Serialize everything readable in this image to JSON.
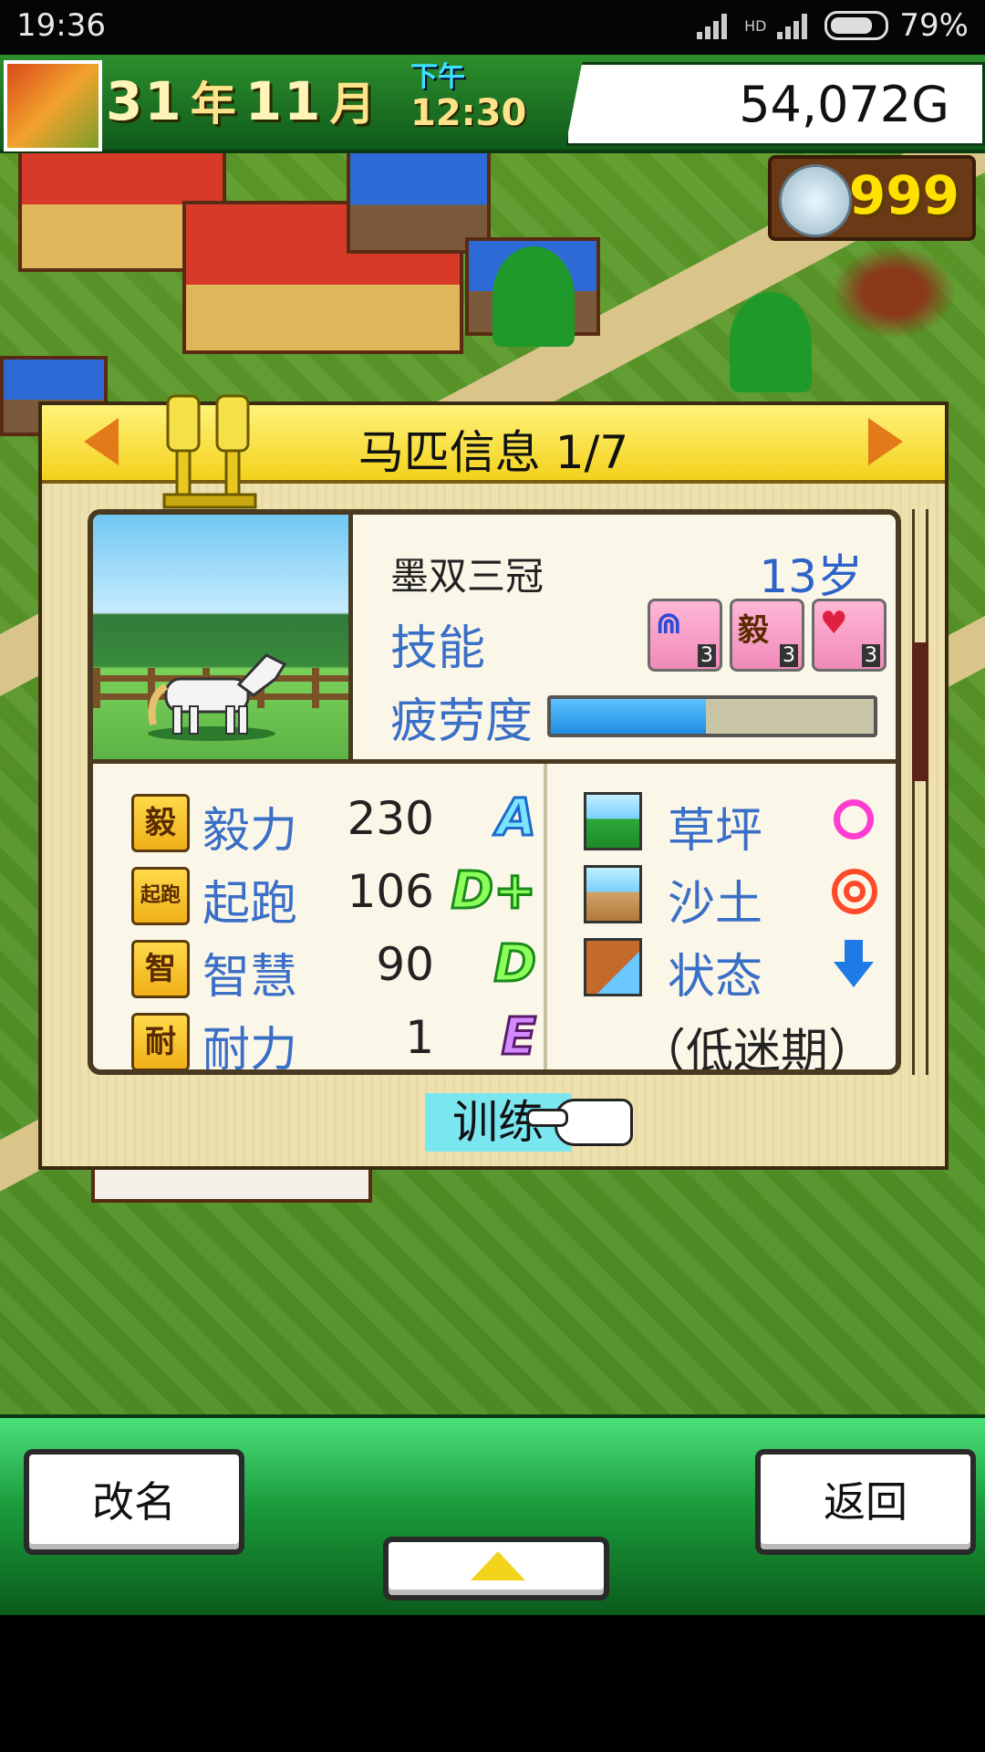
{
  "status_bar": {
    "time": "19:36",
    "battery": "79%",
    "network": "HD"
  },
  "hud": {
    "year": "31",
    "year_unit": "年",
    "month": "11",
    "month_unit": "月",
    "ampm": "下午",
    "clock": "12:30",
    "money": "54,072G",
    "medals": "999"
  },
  "panel": {
    "title": "马匹信息 1/7",
    "horse": {
      "name": "墨双三冠",
      "age": "13岁",
      "skills_label": "技能",
      "fatigue_label": "疲劳度",
      "fatigue_level": 0.48,
      "skills": [
        {
          "icon": "speed-skill-icon",
          "glyph": "⋒",
          "level": "3"
        },
        {
          "icon": "grit-skill-icon",
          "glyph": "毅",
          "level": "3"
        },
        {
          "icon": "heart-skill-icon",
          "glyph": "♥",
          "level": "3"
        }
      ]
    },
    "stats": [
      {
        "icon_text": "毅",
        "name": "毅力",
        "value": "230",
        "grade": "A"
      },
      {
        "icon_text": "起跑",
        "name": "起跑",
        "value": "106",
        "grade": "D+"
      },
      {
        "icon_text": "智",
        "name": "智慧",
        "value": "90",
        "grade": "D"
      },
      {
        "icon_text": "耐",
        "name": "耐力",
        "value": "1",
        "grade": "E"
      }
    ],
    "conditions": [
      {
        "name": "草坪",
        "mark": "single-circle"
      },
      {
        "name": "沙土",
        "mark": "double-circle"
      },
      {
        "name": "状态",
        "mark": "down-arrow"
      }
    ],
    "condition_note": "（低迷期）",
    "train_label": "训练"
  },
  "bottom": {
    "rename_label": "改名",
    "back_label": "返回"
  },
  "colors": {
    "accent_blue": "#3a6fc7",
    "header_yellow": "#f3d21c",
    "hud_green": "#1a7a2a"
  }
}
